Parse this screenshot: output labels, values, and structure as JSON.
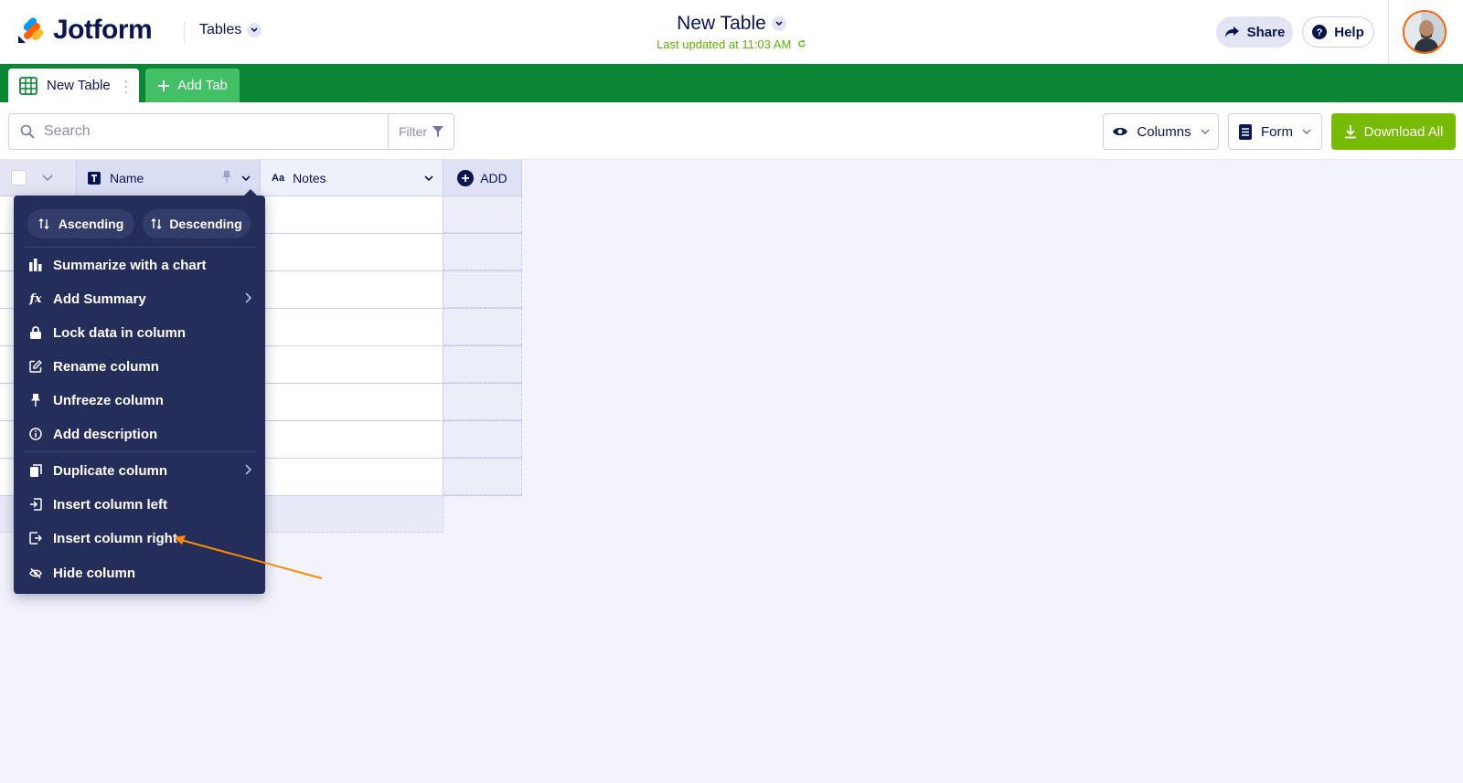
{
  "app": {
    "logo_text": "Jotform",
    "tables_label": "Tables"
  },
  "header": {
    "title": "New Table",
    "subtitle": "Last updated at 11:03 AM",
    "share_label": "Share",
    "help_label": "Help"
  },
  "tabs": {
    "active_label": "New Table",
    "add_label": "Add Tab"
  },
  "toolbar": {
    "search_placeholder": "Search",
    "filter_label": "Filter",
    "columns_label": "Columns",
    "form_label": "Form",
    "download_label": "Download All"
  },
  "grid": {
    "columns": [
      {
        "label": "Name",
        "type_icon": "text-type-icon"
      },
      {
        "label": "Notes",
        "type_icon": "aa-type-icon"
      }
    ],
    "add_label": "ADD"
  },
  "menu": {
    "sort_asc": "Ascending",
    "sort_desc": "Descending",
    "items": [
      {
        "label": "Summarize with a chart",
        "icon": "bar-chart-icon"
      },
      {
        "label": "Add Summary",
        "icon": "fx-icon",
        "submenu": true
      },
      {
        "label": "Lock data in column",
        "icon": "lock-icon"
      },
      {
        "label": "Rename column",
        "icon": "edit-icon"
      },
      {
        "label": "Unfreeze column",
        "icon": "pin-icon"
      },
      {
        "label": "Add description",
        "icon": "info-icon"
      },
      {
        "label": "Duplicate column",
        "icon": "duplicate-icon",
        "submenu": true
      },
      {
        "label": "Insert column left",
        "icon": "insert-left-icon"
      },
      {
        "label": "Insert column right",
        "icon": "insert-right-icon"
      },
      {
        "label": "Hide column",
        "icon": "eye-off-icon"
      }
    ]
  },
  "colors": {
    "brand_green": "#0b8634",
    "menu_bg": "#252d5b",
    "download_green": "#78bb07",
    "annotation_arrow": "#ff8c00",
    "navy": "#0a1551"
  }
}
